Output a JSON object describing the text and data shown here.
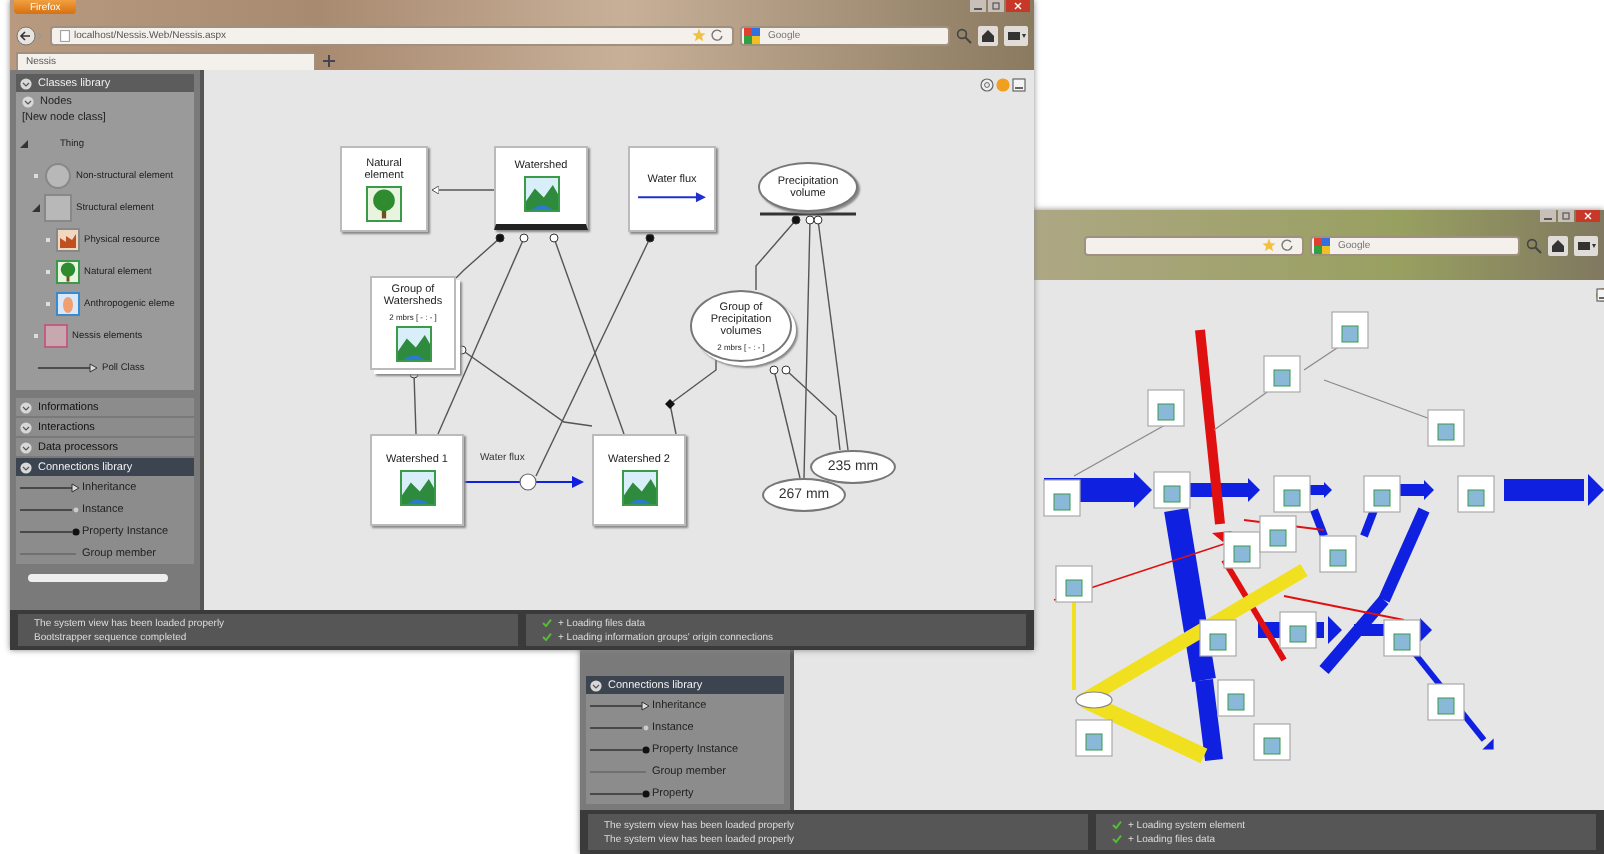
{
  "front_window": {
    "browser": {
      "menu_button": "Firefox",
      "url": "localhost/Nessis.Web/Nessis.aspx",
      "search_placeholder": "Google",
      "tab": "Nessis"
    },
    "sidebar": {
      "classes_header": "Classes library",
      "nodes_header": "Nodes",
      "new_node": "[New node class]",
      "tree": [
        {
          "label": "Thing",
          "expanded": true,
          "children": [
            {
              "label": "Non-structural element",
              "expanded": false
            },
            {
              "label": "Structural element",
              "expanded": true,
              "children": [
                {
                  "label": "Physical resource",
                  "expanded": false
                },
                {
                  "label": "Natural element",
                  "expanded": false
                },
                {
                  "label": "Anthropogenic eleme",
                  "expanded": false
                }
              ]
            },
            {
              "label": "Nessis elements",
              "expanded": false
            }
          ]
        }
      ],
      "poll_class": "Poll Class",
      "panels": [
        {
          "title": "Informations",
          "selected": false
        },
        {
          "title": "Interactions",
          "selected": false
        },
        {
          "title": "Data processors",
          "selected": false
        },
        {
          "title": "Connections library",
          "selected": true
        }
      ],
      "connections": [
        {
          "label": "Inheritance",
          "kind": "inheritance"
        },
        {
          "label": "Instance",
          "kind": "instance"
        },
        {
          "label": "Property Instance",
          "kind": "property_instance"
        },
        {
          "label": "Group member",
          "kind": "group_member"
        }
      ]
    },
    "diagram": {
      "nodes": [
        {
          "label": "Natural element",
          "kind": "box"
        },
        {
          "label": "Watershed",
          "kind": "box"
        },
        {
          "label": "Water flux",
          "kind": "box"
        },
        {
          "label": "Precipitation volume",
          "kind": "ellipse"
        },
        {
          "label": "Group of Watersheds",
          "kind": "group",
          "subtitle": "2 mbrs [ - : - ]"
        },
        {
          "label": "Group of Precipitation volumes",
          "kind": "group_ellipse",
          "subtitle": "2 mbrs [ - : - ]"
        },
        {
          "label": "Watershed 1",
          "kind": "box"
        },
        {
          "label": "Watershed 2",
          "kind": "box"
        },
        {
          "label": "267 mm",
          "kind": "value"
        },
        {
          "label": "235 mm",
          "kind": "value"
        }
      ],
      "edge_label": "Water flux"
    },
    "status": {
      "log": [
        "The system view has been loaded properly",
        "Bootstrapper sequence completed"
      ],
      "progress": [
        "+ Loading files data",
        "+ Loading information groups' origin connections"
      ]
    }
  },
  "back_window": {
    "browser": {
      "search_placeholder": "Google"
    },
    "sidebar": {
      "panels": [
        {
          "title": "Connections library",
          "selected": true
        }
      ],
      "connections": [
        {
          "label": "Inheritance",
          "kind": "inheritance"
        },
        {
          "label": "Instance",
          "kind": "instance"
        },
        {
          "label": "Property Instance",
          "kind": "property_instance"
        },
        {
          "label": "Group member",
          "kind": "group_member"
        },
        {
          "label": "Property",
          "kind": "property"
        }
      ]
    },
    "status": {
      "log": [
        "The system view has been loaded properly",
        "The system view has been loaded properly"
      ],
      "progress": [
        "+ Loading system element",
        "+ Loading files data"
      ]
    }
  }
}
